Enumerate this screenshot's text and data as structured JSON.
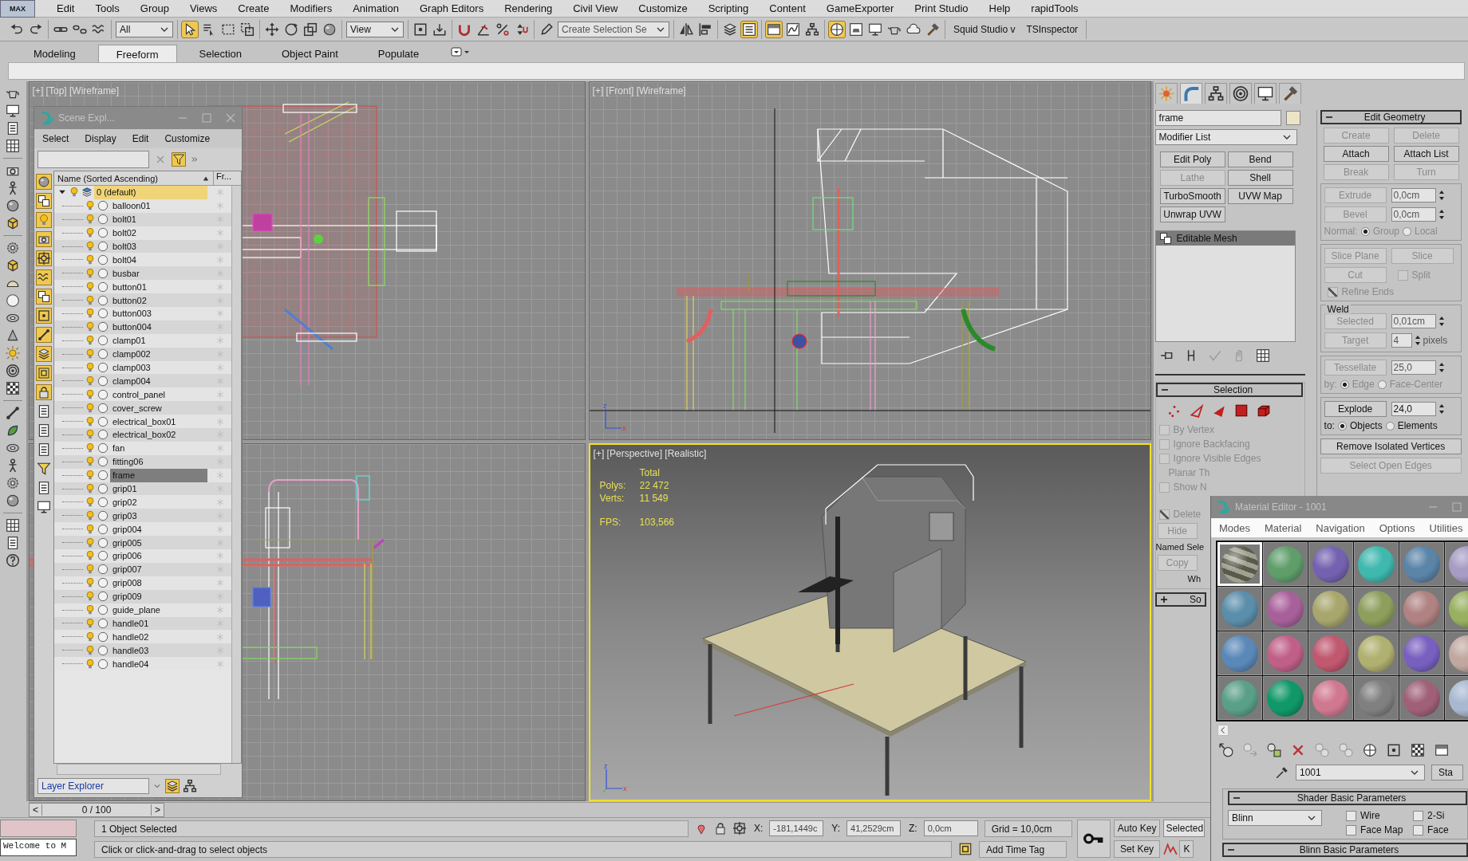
{
  "menu_bar": {
    "logo": "MAX",
    "items": [
      "Edit",
      "Tools",
      "Group",
      "Views",
      "Create",
      "Modifiers",
      "Animation",
      "Graph Editors",
      "Rendering",
      "Civil View",
      "Customize",
      "Scripting",
      "Content",
      "GameExporter",
      "Print Studio",
      "Help",
      "rapidTools"
    ]
  },
  "main_toolbar": {
    "groups": [
      [
        {
          "kind": "undo",
          "on": false
        },
        {
          "kind": "redo",
          "on": false
        }
      ],
      [
        {
          "kind": "link",
          "on": false
        },
        {
          "kind": "unlink",
          "on": false
        },
        {
          "kind": "bind",
          "on": false
        }
      ],
      [
        {
          "kind": "dropdown",
          "value": "All"
        }
      ],
      [
        {
          "kind": "select",
          "on": true
        },
        {
          "kind": "select_name",
          "on": false
        },
        {
          "kind": "rect_region",
          "on": false
        },
        {
          "kind": "window_crossing",
          "on": false
        }
      ],
      [
        {
          "kind": "move",
          "on": false
        },
        {
          "kind": "rotate",
          "on": false
        },
        {
          "kind": "scale",
          "on": false
        },
        {
          "kind": "place",
          "on": false
        }
      ],
      [
        {
          "kind": "dropdown",
          "value": "View"
        }
      ],
      [
        {
          "kind": "pivot",
          "on": false
        },
        {
          "kind": "manipulate",
          "on": false
        }
      ],
      [
        {
          "kind": "snap",
          "on": false
        },
        {
          "kind": "angle_snap",
          "on": false
        },
        {
          "kind": "percent_snap",
          "on": false
        },
        {
          "kind": "spinner_snap",
          "on": false
        }
      ],
      [
        {
          "kind": "named_sets",
          "on": false
        },
        {
          "kind": "dropdown",
          "value": "Create Selection Se"
        }
      ],
      [
        {
          "kind": "mirror",
          "on": false
        },
        {
          "kind": "align",
          "on": false
        }
      ],
      [
        {
          "kind": "layers",
          "on": false
        },
        {
          "kind": "scene_explorer",
          "on": true
        }
      ],
      [
        {
          "kind": "ribbon",
          "on": true
        },
        {
          "kind": "curve_editor",
          "on": false
        },
        {
          "kind": "schematic",
          "on": false
        }
      ],
      [
        {
          "kind": "material",
          "on": true
        },
        {
          "kind": "render_setup",
          "on": false
        },
        {
          "kind": "render_frame",
          "on": false
        },
        {
          "kind": "render",
          "on": false
        },
        {
          "kind": "cloud",
          "on": false
        },
        {
          "kind": "hammer",
          "on": false
        }
      ],
      [
        {
          "kind": "label",
          "text": "Squid Studio v"
        },
        {
          "kind": "label",
          "text": "TSInspector"
        }
      ]
    ]
  },
  "ribbon": {
    "tabs": [
      {
        "label": "Modeling",
        "selected": false
      },
      {
        "label": "Freeform",
        "selected": true
      },
      {
        "label": "Selection",
        "selected": false
      },
      {
        "label": "Object Paint",
        "selected": false
      },
      {
        "label": "Populate",
        "selected": false
      }
    ]
  },
  "viewports": [
    {
      "kind": "top",
      "label": "[+] [Top] [Wireframe]",
      "active": false
    },
    {
      "kind": "front",
      "label": "[+] [Front] [Wireframe]",
      "active": false,
      "axes": [
        "z",
        "x"
      ]
    },
    {
      "kind": "left",
      "active": false
    },
    {
      "kind": "perspective",
      "label": "[+] [Perspective] [Realistic]",
      "active": true,
      "axes": [
        "z",
        "x"
      ],
      "stats": {
        "header": "Total",
        "rows": [
          {
            "label": "Polys:",
            "value": "22 472"
          },
          {
            "label": "Verts:",
            "value": "11 549"
          },
          {
            "label": "FPS:",
            "value": "103,566"
          }
        ]
      }
    }
  ],
  "scene_explorer": {
    "title": "Scene Expl...",
    "menu": [
      "Select",
      "Display",
      "Edit",
      "Customize"
    ],
    "filters": [
      {
        "on": true
      },
      {
        "on": true
      },
      {
        "on": true
      },
      {
        "on": true
      },
      {
        "on": true
      },
      {
        "on": true
      },
      {
        "on": true
      },
      {
        "on": true
      },
      {
        "on": true
      },
      {
        "on": true
      },
      {
        "on": true
      },
      {
        "on": true
      },
      {
        "on": false
      },
      {
        "on": false
      },
      {
        "on": false
      },
      {
        "on": false
      },
      {
        "on": false
      },
      {
        "on": false
      }
    ],
    "columns": [
      "Name (Sorted Ascending)",
      "Fr..."
    ],
    "layer": {
      "name": "0 (default)",
      "expanded": true,
      "active": true,
      "children": [
        {
          "name": "balloon01",
          "selected": false
        },
        {
          "name": "bolt01",
          "selected": false
        },
        {
          "name": "bolt02",
          "selected": false
        },
        {
          "name": "bolt03",
          "selected": false
        },
        {
          "name": "bolt04",
          "selected": false
        },
        {
          "name": "busbar",
          "selected": false
        },
        {
          "name": "button01",
          "selected": false
        },
        {
          "name": "button02",
          "selected": false
        },
        {
          "name": "button003",
          "selected": false
        },
        {
          "name": "button004",
          "selected": false
        },
        {
          "name": "clamp01",
          "selected": false
        },
        {
          "name": "clamp002",
          "selected": false
        },
        {
          "name": "clamp003",
          "selected": false
        },
        {
          "name": "clamp004",
          "selected": false
        },
        {
          "name": "control_panel",
          "selected": false
        },
        {
          "name": "cover_screw",
          "selected": false
        },
        {
          "name": "electrical_box01",
          "selected": false
        },
        {
          "name": "electrical_box02",
          "selected": false
        },
        {
          "name": "fan",
          "selected": false
        },
        {
          "name": "fitting06",
          "selected": false
        },
        {
          "name": "frame",
          "selected": true
        },
        {
          "name": "grip01",
          "selected": false
        },
        {
          "name": "grip02",
          "selected": false
        },
        {
          "name": "grip03",
          "selected": false
        },
        {
          "name": "grip004",
          "selected": false
        },
        {
          "name": "grip005",
          "selected": false
        },
        {
          "name": "grip006",
          "selected": false
        },
        {
          "name": "grip007",
          "selected": false
        },
        {
          "name": "grip008",
          "selected": false
        },
        {
          "name": "grip009",
          "selected": false
        },
        {
          "name": "guide_plane",
          "selected": false
        },
        {
          "name": "handle01",
          "selected": false
        },
        {
          "name": "handle02",
          "selected": false
        },
        {
          "name": "handle03",
          "selected": false
        },
        {
          "name": "handle04",
          "selected": false
        }
      ]
    },
    "explorer_type": "Layer Explorer"
  },
  "command_panel": {
    "tabs": [
      {
        "kind": "create",
        "selected": false
      },
      {
        "kind": "modify",
        "selected": true
      },
      {
        "kind": "hierarchy",
        "selected": false
      },
      {
        "kind": "motion",
        "selected": false
      },
      {
        "kind": "display",
        "selected": false
      },
      {
        "kind": "utilities",
        "selected": false
      }
    ],
    "object_name": "frame",
    "modifier_list": "Modifier List",
    "modifier_buttons": [
      {
        "label": "Edit Poly",
        "disabled": false
      },
      {
        "label": "Bend",
        "disabled": false
      },
      {
        "label": "Lathe",
        "disabled": true
      },
      {
        "label": "Shell",
        "disabled": false
      },
      {
        "label": "TurboSmooth",
        "disabled": false
      },
      {
        "label": "UVW Map",
        "disabled": false
      },
      {
        "label": "Unwrap UVW",
        "disabled": false
      }
    ],
    "stack": [
      {
        "label": "Editable Mesh",
        "selected": true
      }
    ],
    "selection": {
      "title": "Selection",
      "checks": [
        {
          "label": "By Vertex",
          "checked": false,
          "disabled": true
        },
        {
          "label": "Ignore Backfacing",
          "checked": false,
          "disabled": true
        },
        {
          "label": "Ignore Visible Edges",
          "checked": false,
          "disabled": true
        }
      ],
      "planar": "Planar Th",
      "show_check": {
        "label": "Show N",
        "checked": false,
        "disabled": true
      },
      "delete_check": {
        "label": "Delete",
        "checked": true,
        "disabled": true
      },
      "hide_button": "Hide",
      "named_label": "Named Sele",
      "copy_button": "Copy",
      "wh_label": "Wh"
    },
    "soft_selection": {
      "title": "So",
      "expanded": false
    },
    "edit_geometry": {
      "title": "Edit Geometry",
      "buttons": [
        {
          "label": "Create",
          "disabled": true
        },
        {
          "label": "Delete",
          "disabled": true
        },
        {
          "label": "Attach",
          "disabled": false
        },
        {
          "label": "Attach List",
          "disabled": false
        },
        {
          "label": "Break",
          "disabled": true
        },
        {
          "label": "Turn",
          "disabled": true
        }
      ],
      "extrude": {
        "label": "Extrude",
        "value": "0,0cm",
        "disabled": true
      },
      "bevel": {
        "label": "Bevel",
        "value": "0,0cm",
        "disabled": true
      },
      "normal": {
        "label": "Normal:",
        "options": [
          {
            "label": "Group",
            "selected": true
          },
          {
            "label": "Local",
            "selected": false
          }
        ],
        "disabled": true
      },
      "slice_buttons": [
        {
          "label": "Slice Plane",
          "disabled": true
        },
        {
          "label": "Slice",
          "disabled": true
        }
      ],
      "cut": {
        "label": "Cut",
        "disabled": true
      },
      "split": {
        "label": "Split",
        "checked": false,
        "disabled": true
      },
      "refine": {
        "label": "Refine Ends",
        "checked": true,
        "disabled": true
      },
      "weld": {
        "title": "Weld",
        "selected": {
          "label": "Selected",
          "value": "0,01cm",
          "disabled": true
        },
        "target": {
          "label": "Target",
          "value": "4",
          "unit": "pixels",
          "disabled": true
        }
      },
      "tessellate": {
        "label": "Tessellate",
        "value": "25,0",
        "disabled": true
      },
      "by": {
        "label": "by:",
        "options": [
          {
            "label": "Edge",
            "selected": true
          },
          {
            "label": "Face-Center",
            "selected": false
          }
        ],
        "disabled": true
      },
      "explode": {
        "label": "Explode",
        "value": "24,0",
        "disabled": false
      },
      "to": {
        "label": "to:",
        "options": [
          {
            "label": "Objects",
            "selected": true
          },
          {
            "label": "Elements",
            "selected": false
          }
        ],
        "disabled": false
      },
      "remove_isolated": {
        "label": "Remove Isolated Vertices",
        "disabled": false
      },
      "select_open": {
        "label": "Select Open Edges",
        "disabled": true
      }
    }
  },
  "material_editor": {
    "title": "Material Editor - 1001",
    "menu": [
      "Modes",
      "Material",
      "Navigation",
      "Options",
      "Utilities"
    ],
    "slots": [
      {
        "kind": "textured",
        "color": "#8a8a74",
        "selected": true
      },
      {
        "kind": "plain",
        "color": "#5f9e6a",
        "selected": false
      },
      {
        "kind": "plain",
        "color": "#7462b0",
        "selected": false
      },
      {
        "kind": "plain",
        "color": "#3fb8ae",
        "selected": false
      },
      {
        "kind": "plain",
        "color": "#5a84a8",
        "selected": false
      },
      {
        "kind": "plain",
        "color": "#a69cc4",
        "selected": false
      },
      {
        "kind": "plain",
        "color": "#5a8eaa",
        "selected": false
      },
      {
        "kind": "plain",
        "color": "#a8609a",
        "selected": false
      },
      {
        "kind": "plain",
        "color": "#a8a66c",
        "selected": false
      },
      {
        "kind": "plain",
        "color": "#8e9e5c",
        "selected": false
      },
      {
        "kind": "plain",
        "color": "#b08282",
        "selected": false
      },
      {
        "kind": "plain",
        "color": "#98b060",
        "selected": false
      },
      {
        "kind": "plain",
        "color": "#5a88b8",
        "selected": false
      },
      {
        "kind": "plain",
        "color": "#c06088",
        "selected": false
      },
      {
        "kind": "plain",
        "color": "#c05870",
        "selected": false
      },
      {
        "kind": "plain",
        "color": "#b0b070",
        "selected": false
      },
      {
        "kind": "plain",
        "color": "#7860c0",
        "selected": false
      },
      {
        "kind": "plain",
        "color": "#c0a8a0",
        "selected": false
      },
      {
        "kind": "plain",
        "color": "#5aa088",
        "selected": false
      },
      {
        "kind": "plain",
        "color": "#109868",
        "selected": false
      },
      {
        "kind": "plain",
        "color": "#d07890",
        "selected": false
      },
      {
        "kind": "plain",
        "color": "#808080",
        "selected": false
      },
      {
        "kind": "plain",
        "color": "#a06078",
        "selected": false
      },
      {
        "kind": "plain",
        "color": "#a8b8d0",
        "selected": false
      }
    ],
    "material_name": "1001",
    "type_button": "Sta",
    "shader": {
      "title": "Shader Basic Parameters",
      "shader": "Blinn",
      "checks": [
        {
          "label": "Wire",
          "checked": false
        },
        {
          "label": "2-Si",
          "checked": false
        },
        {
          "label": "Face Map",
          "checked": false
        },
        {
          "label": "Face",
          "checked": false
        }
      ]
    },
    "blinn_title": "Blinn Basic Parameters"
  },
  "time_slider": {
    "level": 0,
    "prev": "<",
    "position": "0 / 100",
    "next": ">"
  },
  "status_bar": {
    "listener": "Welcome to M",
    "selection_info": "1 Object Selected",
    "prompt": "Click or click-and-drag to select objects",
    "coords": [
      {
        "label": "X:",
        "value": "-181,1449c"
      },
      {
        "label": "Y:",
        "value": "41,2529cm"
      },
      {
        "label": "Z:",
        "value": "0,0cm"
      }
    ],
    "grid": "Grid = 10,0cm",
    "time_tag": "Add Time Tag",
    "auto_key": "Auto Key",
    "set_key": "Set Key",
    "key_mode": "Selected",
    "key_filters": "K"
  }
}
